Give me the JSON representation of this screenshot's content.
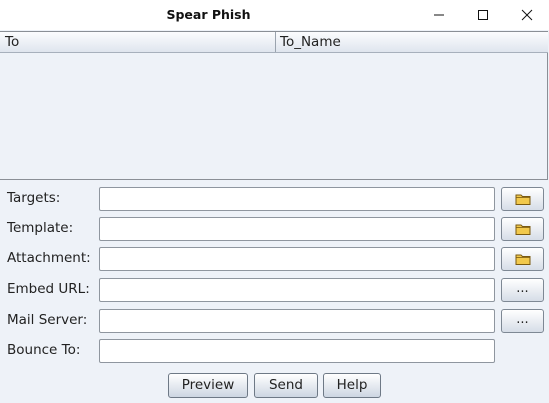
{
  "window": {
    "title": "Spear Phish",
    "minimize_icon": "minimize-icon",
    "maximize_icon": "maximize-icon",
    "close_icon": "close-icon"
  },
  "table": {
    "columns": [
      "To",
      "To_Name"
    ],
    "rows": []
  },
  "form": {
    "targets": {
      "label": "Targets:",
      "value": "",
      "button_icon": "folder-icon"
    },
    "template": {
      "label": "Template:",
      "value": "",
      "button_icon": "folder-icon"
    },
    "attachment": {
      "label": "Attachment:",
      "value": "",
      "button_icon": "folder-icon"
    },
    "embed_url": {
      "label": "Embed URL:",
      "value": "",
      "button_label": "..."
    },
    "mail_server": {
      "label": "Mail Server:",
      "value": "",
      "button_label": "..."
    },
    "bounce_to": {
      "label": "Bounce To:",
      "value": ""
    }
  },
  "buttons": {
    "preview": "Preview",
    "send": "Send",
    "help": "Help"
  },
  "colors": {
    "background": "#eef2f8",
    "folder": "#f2c94c"
  }
}
